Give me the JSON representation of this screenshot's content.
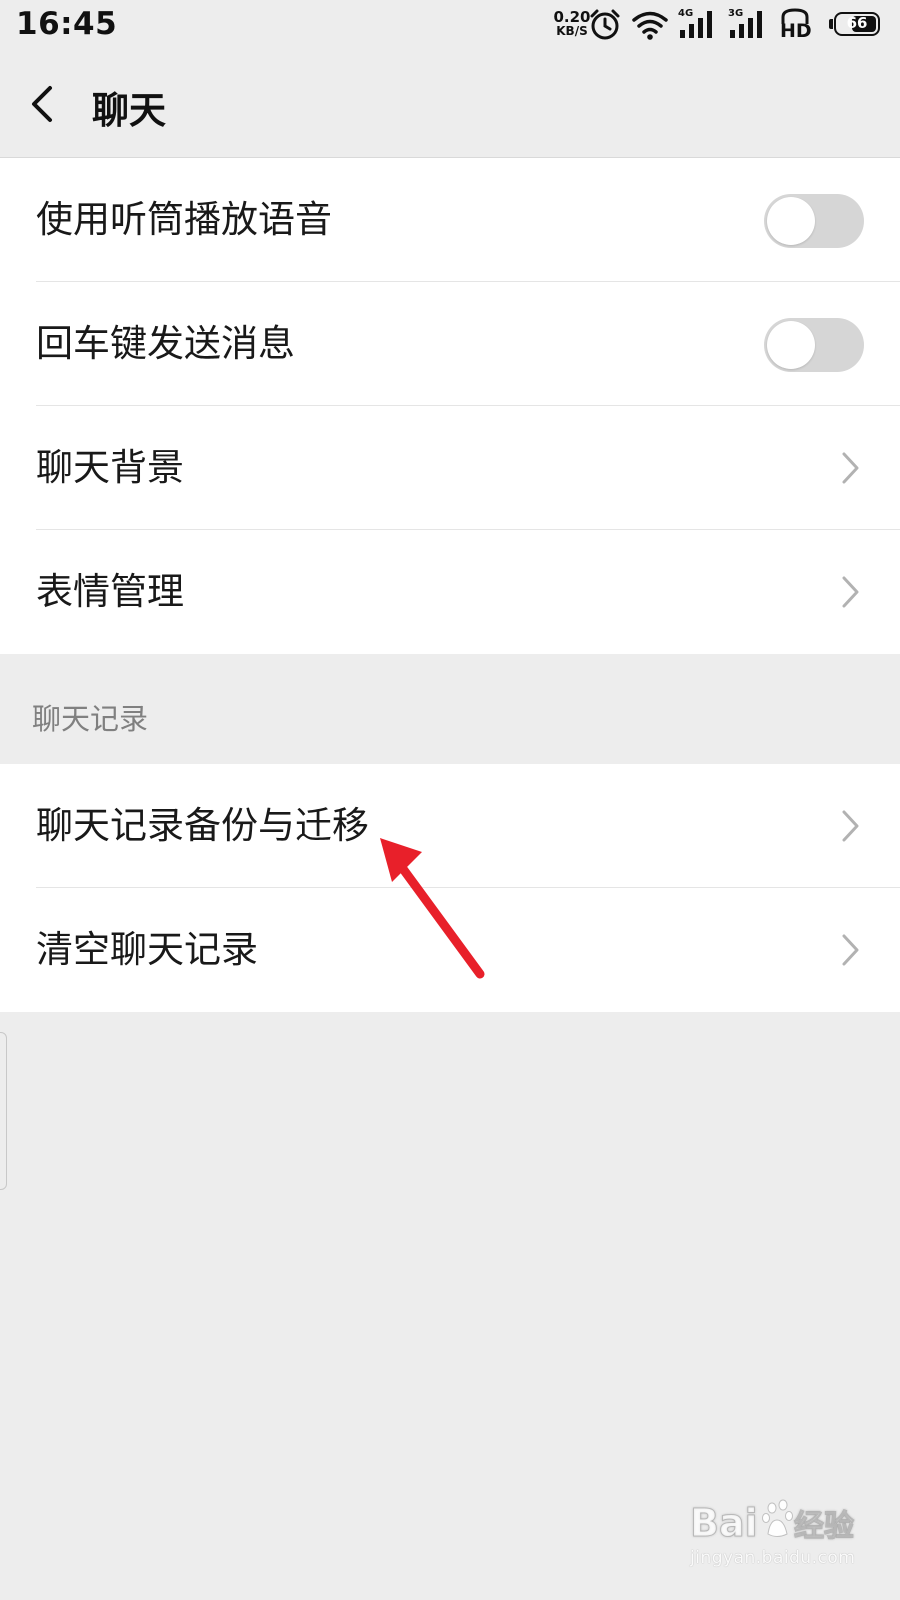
{
  "status_bar": {
    "time": "16:45",
    "net_speed_value": "0.20",
    "net_speed_unit": "KB/S",
    "net1_label": "4G",
    "net2_label": "3G",
    "hd_label": "HD",
    "battery_percent": "66",
    "battery_level": 0.66
  },
  "nav": {
    "title": "聊天"
  },
  "group1": {
    "items": [
      {
        "label": "使用听筒播放语音",
        "control": "toggle",
        "on": false
      },
      {
        "label": "回车键发送消息",
        "control": "toggle",
        "on": false
      },
      {
        "label": "聊天背景",
        "control": "chevron"
      },
      {
        "label": "表情管理",
        "control": "chevron"
      }
    ]
  },
  "section_header": "聊天记录",
  "group2": {
    "items": [
      {
        "label": "聊天记录备份与迁移",
        "control": "chevron"
      },
      {
        "label": "清空聊天记录",
        "control": "chevron"
      }
    ]
  },
  "annotation": {
    "arrow_color": "#e8202a"
  },
  "watermark": {
    "brand": "Baidu经验",
    "url": "jingyan.baidu.com"
  },
  "colors": {
    "background": "#ededed",
    "card": "#ffffff",
    "toggle_off": "#d6d6d6",
    "chevron": "#b2b2b2",
    "section_text": "#808080"
  }
}
